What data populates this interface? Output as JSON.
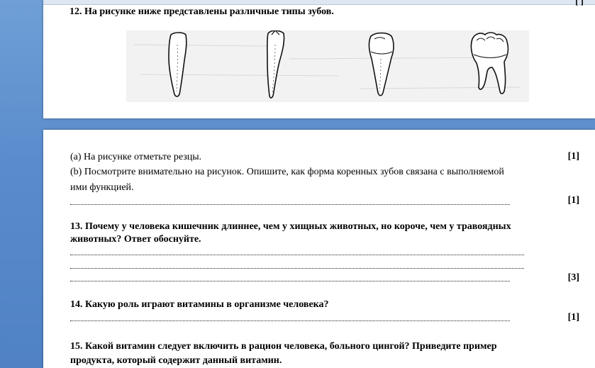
{
  "page1": {
    "top_mark": "[ ]",
    "q12_text": "12. На рисунке ниже представлены различные типы зубов.",
    "figure": {
      "teeth": [
        "incisor-icon",
        "canine-icon",
        "premolar-icon",
        "molar-icon"
      ],
      "background_color": "#f2f2f2"
    }
  },
  "page2": {
    "q12a_text": "(a) На рисунке отметьте резцы.",
    "q12a_mark": "[1]",
    "q12b_line1": "(b) Посмотрите внимательно на рисунок. Опишите, как форма коренных зубов связана с выполняемой",
    "q12b_line2": "ими функцией.",
    "q12b_mark": "[1]",
    "q13_line1": "13. Почему у человека кишечник длиннее, чем у хищных животных, но короче, чем у травоядных",
    "q13_line2": "животных? Ответ обоснуйте.",
    "q13_mark": "[3]",
    "q14_text": "14. Какую роль играют витамины в организме человека?",
    "q14_mark": "[1]",
    "q15_line1": "15. Какой витамин следует включить в рацион человека, больного цингой?  Приведите пример",
    "q15_line2": "продукта, который содержит данный витамин."
  },
  "colors": {
    "workspace": "#5a8ccc",
    "page": "#ffffff",
    "text": "#000000"
  }
}
